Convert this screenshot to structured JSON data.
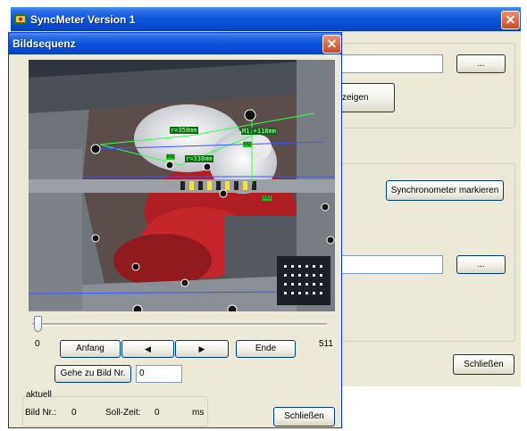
{
  "main_window": {
    "title": "SyncMeter Version 1",
    "browse_label_1": "...",
    "browse_label_2": "...",
    "show_button_label": "zeigen",
    "sync_button_label": "Synchronometer markieren",
    "close_button_label": "Schließen"
  },
  "dialog": {
    "title": "Bildsequenz",
    "slider": {
      "value": 0,
      "min": 0,
      "max": 511
    },
    "slider_min_label": "0",
    "slider_max_label": "511",
    "buttons": {
      "start": "Anfang",
      "prev": "◀",
      "next": "▶",
      "end": "Ende",
      "goto": "Gehe zu Bild Nr.",
      "close": "Schließen"
    },
    "goto_value": "0",
    "current": {
      "legend": "aktuell",
      "frame_label": "Bild Nr.:",
      "frame_value": "0",
      "time_label": "Soll-Zeit:",
      "time_value": "0",
      "time_unit": "ms"
    },
    "image_annotations": {
      "a1": "r=358mm",
      "a2": "M1:+118mm",
      "a3": "r=338mm",
      "m1": "M1",
      "m2": "M2",
      "m3": "M3"
    }
  }
}
